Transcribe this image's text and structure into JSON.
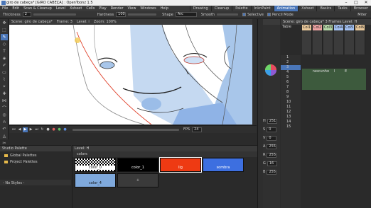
{
  "window": {
    "title": "giro de cabeça* [GIRO CABEÇA] : OpenToonz 1.5",
    "controls": [
      "–",
      "□",
      "✕"
    ]
  },
  "menu": [
    "File",
    "Edit",
    "Scan & Cleanup",
    "Level",
    "Xsheet",
    "Cells",
    "Play",
    "Render",
    "View",
    "Windows",
    "Help"
  ],
  "rooms": [
    {
      "label": "Drawing",
      "active": false
    },
    {
      "label": "Cleanup",
      "active": false
    },
    {
      "label": "Palette",
      "active": false
    },
    {
      "label": "InknPaint",
      "active": false
    },
    {
      "label": "Animation",
      "active": true
    },
    {
      "label": "Xsheet",
      "active": false
    },
    {
      "label": "Basics",
      "active": false
    },
    {
      "label": "Tasks",
      "active": false
    },
    {
      "label": "Browser",
      "active": false
    }
  ],
  "tooloptions": {
    "thickness_label": "Thickness",
    "thickness_value": "2",
    "hardness_label": "Hardness",
    "hardness_value": "100",
    "shape_label": "Shape",
    "shape_value": "Arc",
    "selective_label": "Selective",
    "pencil_mode_label": "Pencil Mode",
    "smooth_label": "Smooth",
    "miter_label": "Miter"
  },
  "viewer": {
    "title": "Scene: giro de cabeça*",
    "frame": "Frame: 3",
    "level": "Level: i",
    "zoom": "Zoom: 100%",
    "fps_label": "FPS",
    "fps_value": "24"
  },
  "xsheet": {
    "title": "Scene: giro de cabeça*   3 Frames Level: H",
    "columns": [
      {
        "name": "Col1",
        "color": "#e8c79a"
      },
      {
        "name": "Col2",
        "color": "#eda3a3"
      },
      {
        "name": "Col3",
        "color": "#b6d7a8"
      },
      {
        "name": "Col4",
        "color": "#a4c2f4"
      },
      {
        "name": "Col5",
        "color": "#a4c2f4"
      },
      {
        "name": "Col6",
        "color": "#e8c79a"
      }
    ],
    "cell_labels": [
      "rascunho",
      "I",
      "E"
    ],
    "frame_numbers": [
      "1",
      "2",
      "3",
      "4",
      "5",
      "6",
      "7",
      "8",
      "9",
      "10",
      "11",
      "12",
      "13",
      "14",
      "15"
    ],
    "table_label": "Table"
  },
  "style_picker": {
    "title": "Studio Palette",
    "items": [
      "Global Palettes",
      "Project Palettes"
    ],
    "no_styles": "- No Styles -"
  },
  "level_palette": {
    "title": "Level: H",
    "palette_name": "colors",
    "styles": [
      {
        "name": "color_0",
        "color": "#ffffff",
        "checker": true
      },
      {
        "name": "color_1",
        "color": "#000000"
      },
      {
        "name": "lig",
        "color": "#ee3a13"
      },
      {
        "name": "sombra",
        "color": "#3d6fe0"
      },
      {
        "name": "color_4",
        "color": "#7fa9dc"
      },
      {
        "name": "+",
        "color": "#3a3a3a"
      }
    ]
  },
  "right_values": [
    "H",
    "S",
    "V",
    "A",
    "R",
    "G",
    "B"
  ],
  "right_numbers": [
    "251",
    "0",
    "0",
    "255",
    "255",
    "16",
    "255"
  ]
}
